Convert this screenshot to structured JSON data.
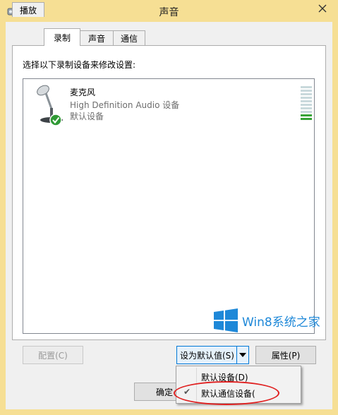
{
  "window": {
    "title": "声音"
  },
  "tabs": [
    {
      "label": "播放"
    },
    {
      "label": "录制"
    },
    {
      "label": "声音"
    },
    {
      "label": "通信"
    }
  ],
  "panel": {
    "instruction": "选择以下录制设备来修改设置:"
  },
  "device": {
    "name": "麦克风",
    "description": "High Definition Audio 设备",
    "status": "默认设备",
    "level_meter": {
      "segments": 10,
      "active_segments": 2
    },
    "icon": "microphone-icon",
    "status_icon": "green-check-icon"
  },
  "buttons": {
    "configure": "配置(C)",
    "set_default": "设为默认值(S)",
    "properties": "属性(P)",
    "ok": "确定"
  },
  "dropdown_menu": [
    {
      "label": "默认设备(D)",
      "checked": false
    },
    {
      "label": "默认通信设备(",
      "checked": true
    }
  ],
  "watermark": {
    "text": "Win8系统之家",
    "color": "#1e88d8"
  },
  "colors": {
    "titlebar": "#f6df94",
    "highlight_ellipse": "#e02020",
    "level_active": "#37a337"
  }
}
